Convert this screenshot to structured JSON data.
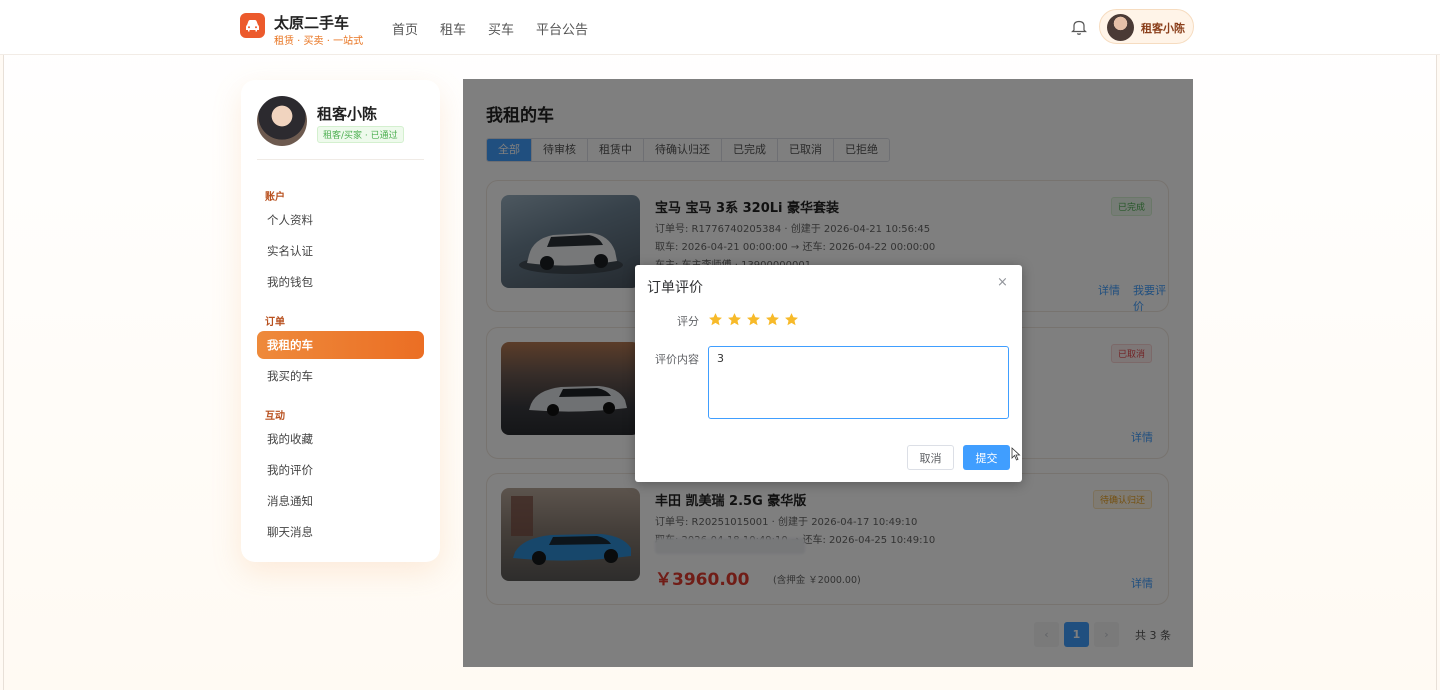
{
  "header": {
    "brand_title": "太原二手车",
    "brand_sub": "租赁 · 买卖 · 一站式",
    "nav": [
      "首页",
      "租车",
      "买车",
      "平台公告"
    ],
    "user_name": "租客小陈"
  },
  "sidebar": {
    "name": "租客小陈",
    "badge": "租客/买家 · 已通过",
    "sections": {
      "account": "账户",
      "orders": "订单",
      "interact": "互动"
    },
    "items": {
      "profile": "个人资料",
      "realname": "实名认证",
      "wallet": "我的钱包",
      "rented": "我租的车",
      "bought": "我买的车",
      "favorites": "我的收藏",
      "reviews": "我的评价",
      "messages": "消息通知",
      "chat": "聊天消息"
    }
  },
  "main": {
    "title": "我租的车",
    "tabs": [
      "全部",
      "待审核",
      "租赁中",
      "待确认归还",
      "已完成",
      "已取消",
      "已拒绝"
    ],
    "active_tab": "全部",
    "cards": [
      {
        "title": "宝马 宝马 3系 320Li 豪华套装",
        "order_line": "订单号: R1776740205384 · 创建于 2026-04-21 10:56:45",
        "time_line": "取车: 2026-04-21 00:00:00 → 还车: 2026-04-22 00:00:00",
        "owner_line": "车主: 车主李师傅 · 13900000001",
        "status": "已完成",
        "actions": [
          "详情",
          "我要评价"
        ]
      },
      {
        "status": "已取消",
        "actions": [
          "详情"
        ]
      },
      {
        "title": "丰田 凯美瑞 2.5G 豪华版",
        "order_line": "订单号: R20251015001 · 创建于 2026-04-17 10:49:10",
        "time_line": "取车: 2026-04-18 10:49:10 → 还车: 2026-04-25 10:49:10",
        "price": "￥3960.00",
        "deposit": "(含押金 ￥2000.00)",
        "status": "待确认归还",
        "actions": [
          "详情"
        ]
      }
    ],
    "pagination": {
      "prev": "‹",
      "current": "1",
      "next": "›",
      "total": "共 3 条"
    }
  },
  "dialog": {
    "title": "订单评价",
    "close": "×",
    "rating_label": "评分",
    "rating": 5,
    "rating_max": 5,
    "content_label": "评价内容",
    "content_value": "3",
    "cancel": "取消",
    "submit": "提交"
  },
  "colors": {
    "accent": "#eb6e24",
    "primary": "#409eff",
    "star": "#f7ba2a",
    "price": "#e03a2e"
  }
}
